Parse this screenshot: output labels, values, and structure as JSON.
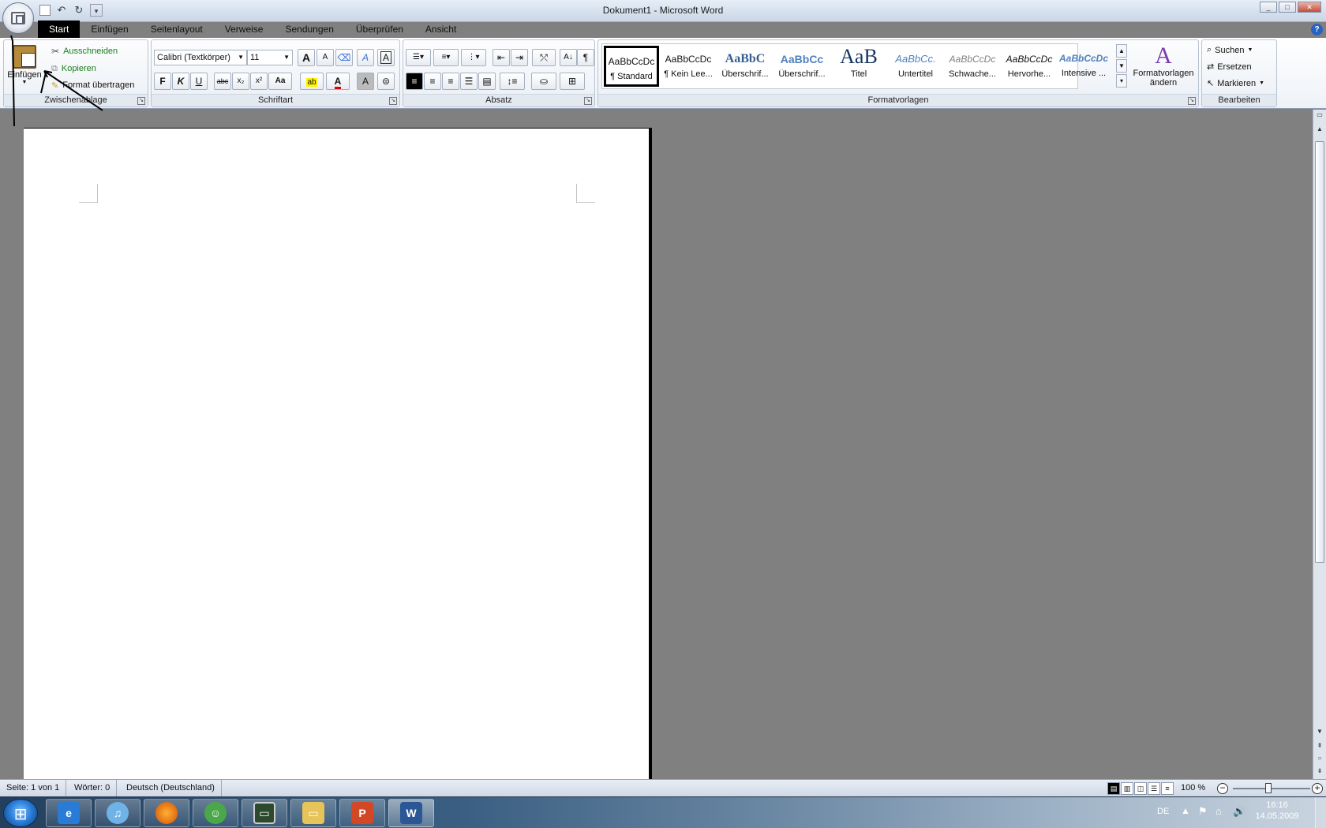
{
  "window": {
    "title": "Dokument1 - Microsoft Word",
    "controls": [
      "_",
      "□",
      "✕"
    ]
  },
  "quick_access": {
    "save": "💾",
    "undo": "↶",
    "redo": "↻",
    "customize": "▾"
  },
  "tabs": [
    "Start",
    "Einfügen",
    "Seitenlayout",
    "Verweise",
    "Sendungen",
    "Überprüfen",
    "Ansicht"
  ],
  "active_tab": "Start",
  "help": "?",
  "clipboard": {
    "group_label": "Zwischenablage",
    "paste_label": "Einfügen",
    "cut_label": "Ausschneiden",
    "copy_label": "Kopieren",
    "format_painter_label": "Format übertragen"
  },
  "font": {
    "group_label": "Schriftart",
    "font_name": "Calibri (Textkörper)",
    "font_size": "11",
    "grow": "A",
    "shrink": "A",
    "bold": "F",
    "italic": "K",
    "underline": "U",
    "strikethrough": "abc",
    "subscript": "x₂",
    "superscript": "x²",
    "case": "Aa",
    "font_color": "A",
    "highlight": "ab"
  },
  "paragraph": {
    "group_label": "Absatz",
    "pilcrow": "¶"
  },
  "styles": {
    "group_label": "Formatvorlagen",
    "items": [
      {
        "sample": "AaBbCcDc",
        "name": "¶ Standard"
      },
      {
        "sample": "AaBbCcDc",
        "name": "¶ Kein Lee..."
      },
      {
        "sample": "AaBbC",
        "name": "Überschrif..."
      },
      {
        "sample": "AaBbCc",
        "name": "Überschrif..."
      },
      {
        "sample": "AaB",
        "name": "Titel"
      },
      {
        "sample": "AaBbCc.",
        "name": "Untertitel"
      },
      {
        "sample": "AaBbCcDc",
        "name": "Schwache..."
      },
      {
        "sample": "AaBbCcDc",
        "name": "Hervorhe..."
      },
      {
        "sample": "AaBbCcDc",
        "name": "Intensive ..."
      }
    ],
    "change_label_1": "Formatvorlagen",
    "change_label_2": "ändern"
  },
  "editing": {
    "group_label": "Bearbeiten",
    "find_label": "Suchen",
    "replace_label": "Ersetzen",
    "select_label": "Markieren"
  },
  "statusbar": {
    "page": "Seite: 1 von 1",
    "words": "Wörter: 0",
    "language": "Deutsch (Deutschland)",
    "zoom": "100 %"
  },
  "taskbar": {
    "language": "DE",
    "time": "16:16",
    "date": "14.05.2009",
    "apps": [
      "internet-explorer",
      "itunes",
      "firefox",
      "messenger",
      "system-monitor",
      "explorer",
      "powerpoint",
      "word"
    ]
  },
  "colors": {
    "active_tab": "#000000",
    "ribbon_bg": "#eef2f7",
    "doc_bg": "#808080",
    "link_green": "#1a7f1a"
  }
}
